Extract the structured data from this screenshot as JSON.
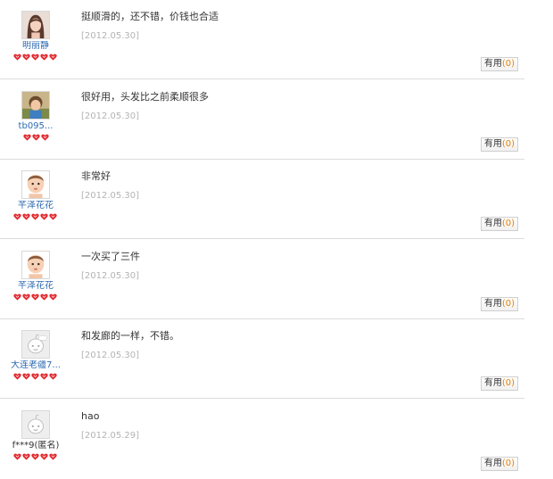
{
  "useful_label": "有用",
  "colors": {
    "username": "#2e6ab1",
    "date": "#b3b3b3",
    "rank_heart": "#e0272d",
    "useful_count": "#e67e00",
    "divider": "#dcdcdc"
  },
  "reviews": [
    {
      "username": "明丽静",
      "avatar": "avatar-woman-photo-icon",
      "rank_hearts": 5,
      "comment": "挺顺滑的，还不错，价钱也合适",
      "date": "[2012.05.30]",
      "useful_count": "(0)"
    },
    {
      "username": "tb095...",
      "avatar": "avatar-child-photo-icon",
      "rank_hearts": 3,
      "comment": "很好用，头发比之前柔顺很多",
      "date": "[2012.05.30]",
      "useful_count": "(0)"
    },
    {
      "username": "芊泽花花",
      "avatar": "avatar-baby-photo-icon",
      "rank_hearts": 5,
      "comment": "非常好",
      "date": "[2012.05.30]",
      "useful_count": "(0)"
    },
    {
      "username": "芊泽花花",
      "avatar": "avatar-baby-photo-icon",
      "rank_hearts": 5,
      "comment": "一次买了三件",
      "date": "[2012.05.30]",
      "useful_count": "(0)"
    },
    {
      "username": "大连老疆7...",
      "avatar": "avatar-default-doll-icon",
      "rank_hearts": 5,
      "comment": "和发廊的一样，不错。",
      "date": "[2012.05.30]",
      "useful_count": "(0)"
    },
    {
      "username": "f***9(匿名)",
      "avatar": "avatar-default-doll-icon",
      "rank_hearts": 5,
      "comment": "hao",
      "date": "[2012.05.29]",
      "useful_count": "(0)"
    }
  ]
}
